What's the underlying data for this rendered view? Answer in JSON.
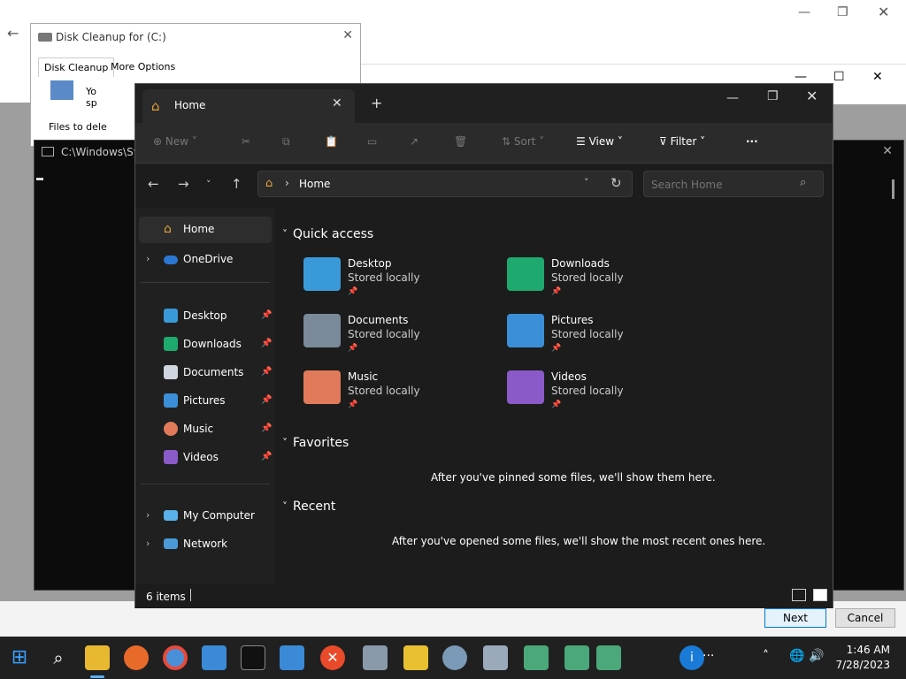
{
  "disk_cleanup": {
    "title": "Disk Cleanup for  (C:)",
    "tab_disk_cleanup": "Disk Cleanup",
    "tab_more_options": "More Options",
    "body_text": "Yo\nsp",
    "files_label": "Files to dele"
  },
  "cmd": {
    "title": "C:\\Windows\\Sys"
  },
  "explorer": {
    "tab_label": "Home",
    "toolbar": {
      "new": "New",
      "sort": "Sort",
      "view": "View",
      "filter": "Filter",
      "more": "···"
    },
    "address": {
      "text": "Home"
    },
    "search": {
      "placeholder": "Search Home"
    },
    "sidebar": {
      "items": [
        {
          "label": "Home"
        },
        {
          "label": "OneDrive"
        },
        {
          "label": "Desktop"
        },
        {
          "label": "Downloads"
        },
        {
          "label": "Documents"
        },
        {
          "label": "Pictures"
        },
        {
          "label": "Music"
        },
        {
          "label": "Videos"
        },
        {
          "label": "My Computer"
        },
        {
          "label": "Network"
        }
      ]
    },
    "content": {
      "quick_access_title": "Quick access",
      "quick_access": [
        {
          "name": "Desktop",
          "sub": "Stored locally",
          "color": "#3a9ad9"
        },
        {
          "name": "Downloads",
          "sub": "Stored locally",
          "color": "#1ea96e"
        },
        {
          "name": "Documents",
          "sub": "Stored locally",
          "color": "#7a8a9a"
        },
        {
          "name": "Pictures",
          "sub": "Stored locally",
          "color": "#3b8fd8"
        },
        {
          "name": "Music",
          "sub": "Stored locally",
          "color": "#e07a5a"
        },
        {
          "name": "Videos",
          "sub": "Stored locally",
          "color": "#8a5ac8"
        }
      ],
      "favorites_title": "Favorites",
      "favorites_empty": "After you've pinned some files, we'll show them here.",
      "recent_title": "Recent",
      "recent_empty": "After you've opened some files, we'll show the most recent ones here."
    },
    "status": {
      "count": "6 items"
    }
  },
  "dialog": {
    "next": "Next",
    "cancel": "Cancel"
  },
  "taskbar": {
    "time": "1:46 AM",
    "date": "7/28/2023"
  }
}
